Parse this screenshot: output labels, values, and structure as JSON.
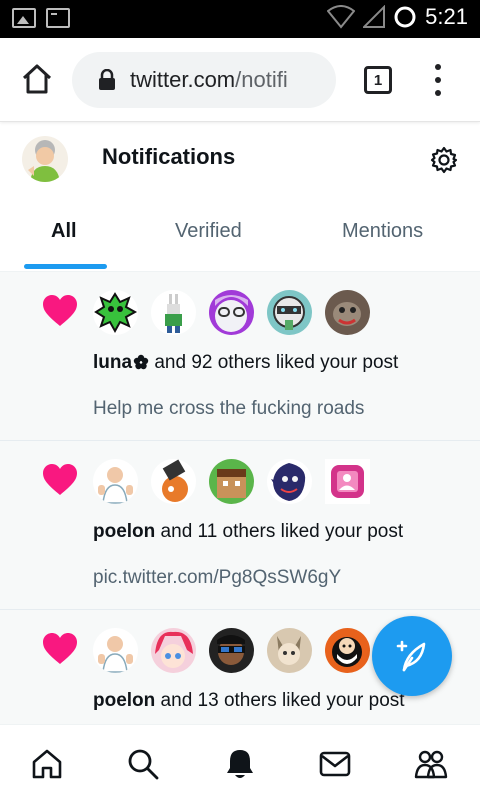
{
  "status_bar": {
    "time": "5:21"
  },
  "browser": {
    "url_host": "twitter.com",
    "url_path": "/notifi",
    "tab_count": "1"
  },
  "header": {
    "title": "Notifications"
  },
  "tabs": [
    {
      "label": "All",
      "active": true
    },
    {
      "label": "Verified",
      "active": false
    },
    {
      "label": "Mentions",
      "active": false
    }
  ],
  "notifications": [
    {
      "actor": "luna",
      "actor_suffix_icon": "flower-icon",
      "message": " and 92 others liked your post",
      "preview": "Help me cross the fucking roads"
    },
    {
      "actor": "poelon",
      "message": " and 11 others liked your post",
      "preview": "pic.twitter.com/Pg8QsSW6gY"
    },
    {
      "actor": "poelon",
      "message": " and 13 others liked your post",
      "preview": ""
    }
  ],
  "colors": {
    "accent": "#1d9bf0",
    "like": "#f91880",
    "text_primary": "#0f1419",
    "text_secondary": "#536471"
  },
  "bottom_nav": [
    "home-icon",
    "search-icon",
    "notifications-bell-icon",
    "messages-icon",
    "communities-icon"
  ]
}
